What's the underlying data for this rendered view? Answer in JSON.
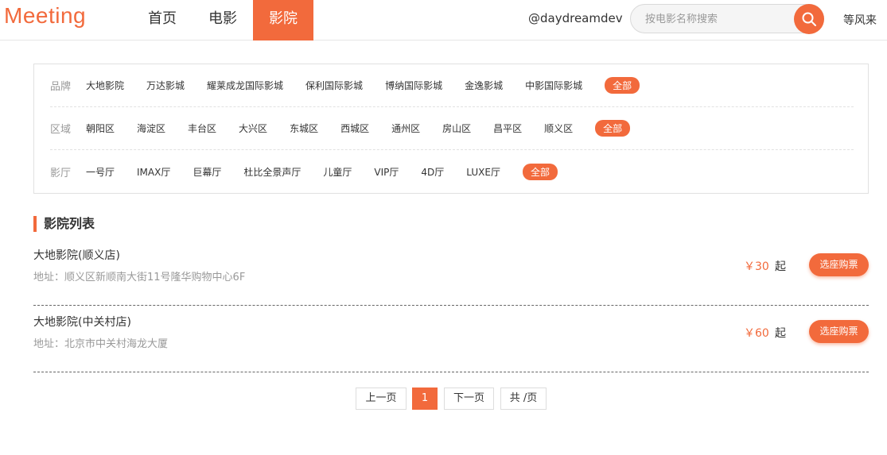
{
  "header": {
    "logo": "Meeting",
    "nav": [
      {
        "label": "首页"
      },
      {
        "label": "电影"
      },
      {
        "label": "影院"
      }
    ],
    "active_nav": 2,
    "username": "@daydreamdev",
    "search_placeholder": "按电影名称搜索",
    "search_icon": "search-icon",
    "logout_label": "等风来"
  },
  "filters": {
    "brand": {
      "label": "品牌",
      "options": [
        "大地影院",
        "万达影城",
        "耀莱成龙国际影城",
        "保利国际影城",
        "博纳国际影城",
        "金逸影城",
        "中影国际影城",
        "全部"
      ],
      "selected": "全部"
    },
    "district": {
      "label": "区域",
      "options": [
        "朝阳区",
        "海淀区",
        "丰台区",
        "大兴区",
        "东城区",
        "西城区",
        "通州区",
        "房山区",
        "昌平区",
        "顺义区",
        "全部"
      ],
      "selected": "全部"
    },
    "hall": {
      "label": "影厅",
      "options": [
        "一号厅",
        "IMAX厅",
        "巨幕厅",
        "杜比全景声厅",
        "儿童厅",
        "VIP厅",
        "4D厅",
        "LUXE厅",
        "全部"
      ],
      "selected": "全部"
    }
  },
  "list": {
    "title": "影院列表",
    "cinemas": [
      {
        "name": "大地影院(顺义店)",
        "address": "地址：顺义区新顺南大街11号隆华购物中心6F",
        "price": "￥30",
        "price_suffix": "起",
        "button": "选座购票"
      },
      {
        "name": "大地影院(中关村店)",
        "address": "地址：北京市中关村海龙大厦",
        "price": "￥60",
        "price_suffix": "起",
        "button": "选座购票"
      }
    ]
  },
  "pagination": {
    "prev": "上一页",
    "current": "1",
    "next": "下一页",
    "total": "共 /页"
  },
  "colors": {
    "accent": "#f26a3c"
  }
}
